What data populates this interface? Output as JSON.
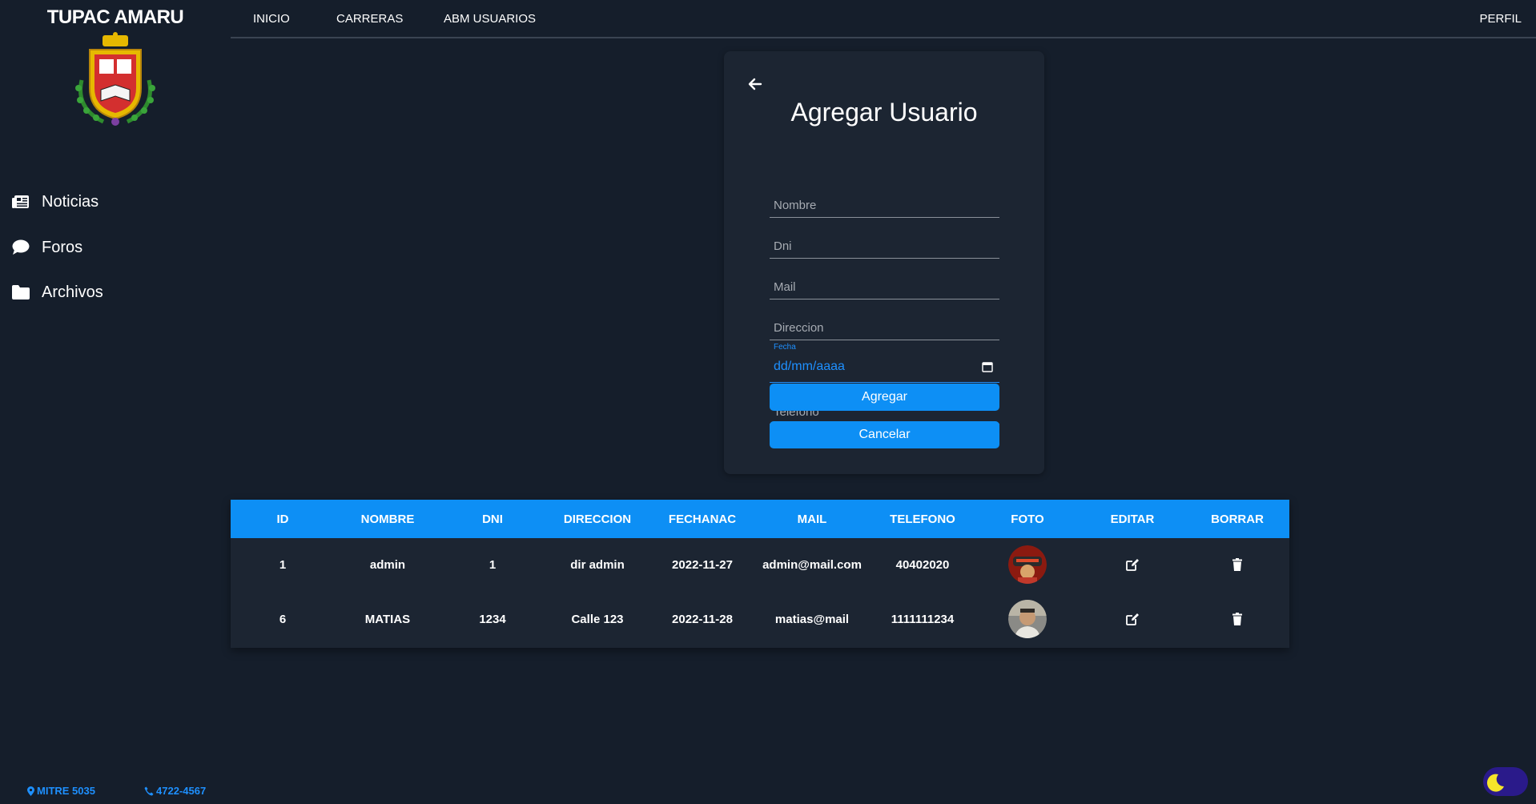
{
  "brand": {
    "title": "TUPAC AMARU"
  },
  "sidebar": {
    "items": [
      {
        "label": "Noticias",
        "icon": "newspaper-icon"
      },
      {
        "label": "Foros",
        "icon": "comment-icon"
      },
      {
        "label": "Archivos",
        "icon": "folder-icon"
      }
    ]
  },
  "nav": {
    "links": [
      "INICIO",
      "CARRERAS",
      "ABM USUARIOS"
    ],
    "profile": "PERFIL"
  },
  "form": {
    "title": "Agregar Usuario",
    "fields": {
      "nombre": "Nombre",
      "dni": "Dni",
      "mail": "Mail",
      "direccion": "Direccion",
      "fecha_label": "Fecha",
      "fecha_value": "dd/mm/aaaa",
      "telefono": "Telefono"
    },
    "buttons": {
      "agregar": "Agregar",
      "cancelar": "Cancelar"
    }
  },
  "table": {
    "headers": [
      "ID",
      "NOMBRE",
      "DNI",
      "DIRECCION",
      "FECHANAC",
      "MAIL",
      "TELEFONO",
      "FOTO",
      "EDITAR",
      "BORRAR"
    ],
    "rows": [
      {
        "id": "1",
        "nombre": "admin",
        "dni": "1",
        "direccion": "dir admin",
        "fechanac": "2022-11-27",
        "mail": "admin@mail.com",
        "telefono": "40402020"
      },
      {
        "id": "6",
        "nombre": "MATIAS",
        "dni": "1234",
        "direccion": "Calle 123",
        "fechanac": "2022-11-28",
        "mail": "matias@mail",
        "telefono": "1111111234"
      }
    ]
  },
  "footer": {
    "address": "MITRE 5035",
    "phone": "4722-4567"
  },
  "colors": {
    "accent": "#0d8ff5",
    "background": "#151e2b",
    "card": "#1c2532"
  }
}
